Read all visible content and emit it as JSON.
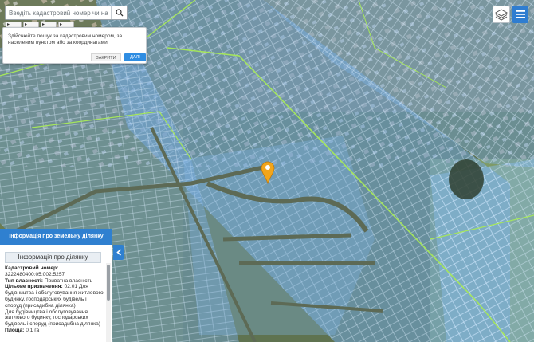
{
  "search": {
    "placeholder": "Введіть кадастровий номер чи населе"
  },
  "mini_tools": [
    "▸",
    "▸",
    "▸",
    "▸"
  ],
  "hint": {
    "text": "Здійснюйте пошук за кадастровим номером, за населеним пунктом або за координатами.",
    "cancel_label": "ЗАКРИТИ",
    "confirm_label": "ДАЛІ"
  },
  "panel": {
    "header": "Інформація про земельну ділянку",
    "title": "Інформація про ділянку",
    "cadastral_label": "Кадастровий номер:",
    "cadastral_value": "3222480400:05:002:5257",
    "ownership_label": "Тип власності:",
    "ownership_value": "Приватна власність",
    "purpose_label": "Цільове призначення:",
    "purpose_value": "02.01 Для будівництва і обслуговування житлового будинку, господарських будівель і споруд (присадибна ділянка)",
    "use_value": "Для будівництва і обслуговування житлового будинку, господарських будівель і споруд (присадибна ділянка)",
    "area_label": "Площа:",
    "area_value": "0.1 га"
  },
  "icons": {
    "search": "search-icon",
    "layers": "layers-icon",
    "menu": "menu-icon",
    "collapse": "chevron-left-icon",
    "marker": "map-marker-icon"
  },
  "colors": {
    "accent": "#2f80d0",
    "marker": "#f2a51a",
    "parcel_fill": "#7fb4e8",
    "parcel_stroke": "#d8ecff",
    "boundary": "#9fe05a"
  }
}
